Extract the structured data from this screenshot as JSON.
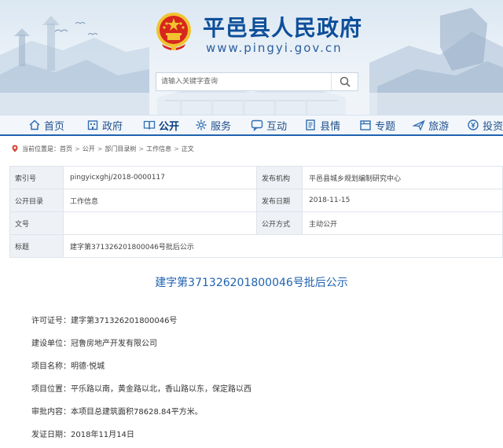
{
  "header": {
    "title": "平邑县人民政府",
    "url": "www.pingyi.gov.cn"
  },
  "search": {
    "placeholder": "请输入关键字查询"
  },
  "nav": {
    "items": [
      {
        "label": "首页",
        "icon": "home-icon"
      },
      {
        "label": "政府",
        "icon": "building-icon"
      },
      {
        "label": "公开",
        "icon": "book-icon"
      },
      {
        "label": "服务",
        "icon": "settings-icon"
      },
      {
        "label": "互动",
        "icon": "chat-icon"
      },
      {
        "label": "县情",
        "icon": "document-icon"
      },
      {
        "label": "专题",
        "icon": "folder-icon"
      },
      {
        "label": "旅游",
        "icon": "plane-icon"
      },
      {
        "label": "投资",
        "icon": "coin-icon"
      }
    ],
    "active": "公开"
  },
  "breadcrumb": {
    "prefix": "当前位置是：",
    "items": [
      "首页",
      "公开",
      "部门目录树",
      "工作信息",
      "正文"
    ],
    "separator": ">"
  },
  "info": {
    "index_label": "索引号",
    "index_value": "pingyicxghj/2018-0000117",
    "org_label": "发布机构",
    "org_value": "平邑县城乡规划编制研究中心",
    "catalog_label": "公开目录",
    "catalog_value": "工作信息",
    "date_label": "发布日期",
    "date_value": "2018-11-15",
    "docno_label": "文号",
    "docno_value": "",
    "method_label": "公开方式",
    "method_value": "主动公开",
    "title_label": "标题",
    "title_value": "建字第371326201800046号批后公示"
  },
  "article": {
    "title": "建字第371326201800046号批后公示",
    "lines": [
      "许可证号：建字第371326201800046号",
      "建设单位：冠鲁房地产开发有限公司",
      "项目名称：明德·悦城",
      "项目位置：平乐路以南，黄金路以北，香山路以东，保定路以西",
      "审批内容：本项目总建筑面积78628.84平方米。",
      "发证日期：2018年11月14日"
    ]
  },
  "colors": {
    "brand": "#0e4f9a",
    "nav_border": "#1f62b0",
    "title_blue": "#1f62b0",
    "emblem_red": "#d7261e",
    "emblem_gold": "#f2c230"
  }
}
